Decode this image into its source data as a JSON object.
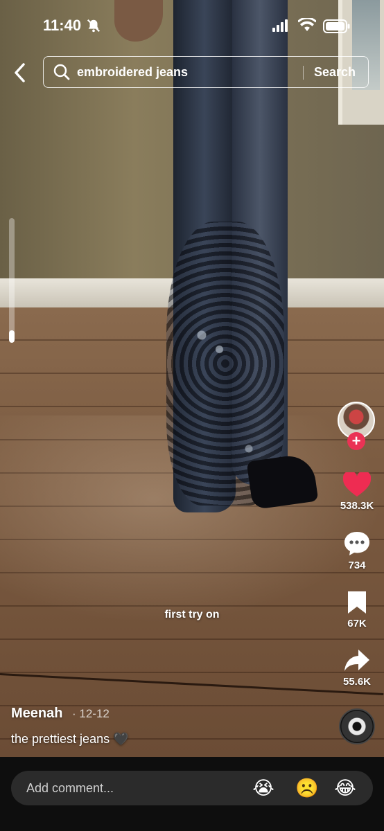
{
  "status_bar": {
    "time": "11:40",
    "silent_icon": "bell-slash-icon",
    "signal_icon": "cellular-signal-icon",
    "wifi_icon": "wifi-icon",
    "battery_icon": "battery-icon"
  },
  "search": {
    "query": "embroidered jeans",
    "button_label": "Search"
  },
  "volume": {
    "level": 0.1
  },
  "video": {
    "overlay_text": "first try on",
    "author": "Meenah",
    "date": "· 12-12",
    "caption": "the prettiest jeans 🖤"
  },
  "actions": {
    "likes": "538.3K",
    "comments": "734",
    "saves": "67K",
    "shares": "55.6K",
    "like_color": "#ee2c52"
  },
  "comment_bar": {
    "placeholder": "Add comment...",
    "emojis": [
      "😭",
      "☹️",
      "😂"
    ]
  }
}
